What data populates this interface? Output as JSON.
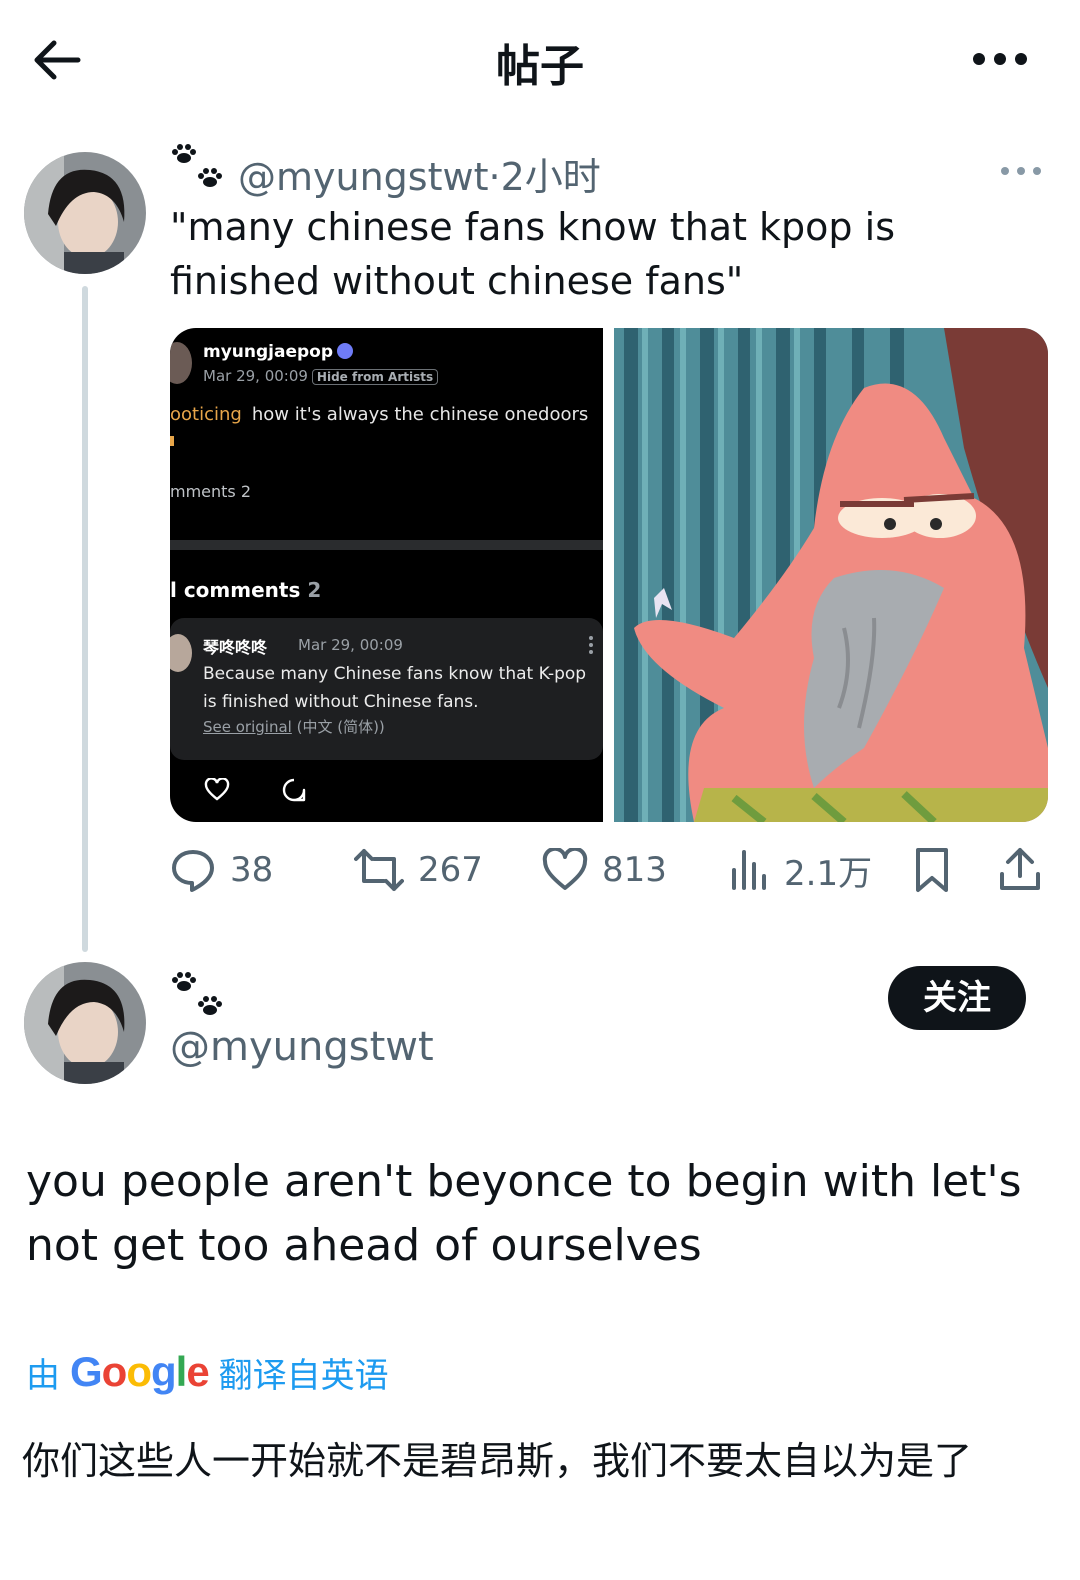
{
  "header": {
    "title": "帖子"
  },
  "quoted_post": {
    "handle": "@myungstwt",
    "separator": "·",
    "time": "2小时",
    "text": "\"many chinese fans know that kpop is finished without chinese fans\"",
    "screenshot": {
      "username": "myungjaepop",
      "date": "Mar 29, 00:09",
      "hide_tag": "Hide from Artists",
      "noticing": "ooticing",
      "noticing_text": "how it's always the chinese onedoors",
      "comments_partial": "mments 2",
      "all_comments_label": "l comments",
      "all_comments_count": "2",
      "comment": {
        "name": "琴咚咚咚",
        "date": "Mar 29, 00:09",
        "text": "Because many Chinese fans know that K-pop is finished without Chinese fans.",
        "see_original": "See original",
        "lang": "(中文 (简体))"
      }
    },
    "stats": {
      "replies": "38",
      "reposts": "267",
      "likes": "813",
      "views": "2.1万"
    }
  },
  "reply_post": {
    "handle": "@myungstwt",
    "follow_label": "关注",
    "text": "you people aren't beyonce to begin with let's not get too ahead of ourselves",
    "translate_by": "由",
    "translate_brand": [
      "G",
      "o",
      "o",
      "g",
      "l",
      "e"
    ],
    "translate_suffix": "翻译自英语",
    "translated_text": "你们这些人一开始就不是碧昂斯，我们不要太自以为是了"
  },
  "colors": {
    "text": "#0f1419",
    "muted": "#536471",
    "link": "#1d9bf0",
    "thread_line": "#cfd9de",
    "button_dark": "#0f1419"
  }
}
